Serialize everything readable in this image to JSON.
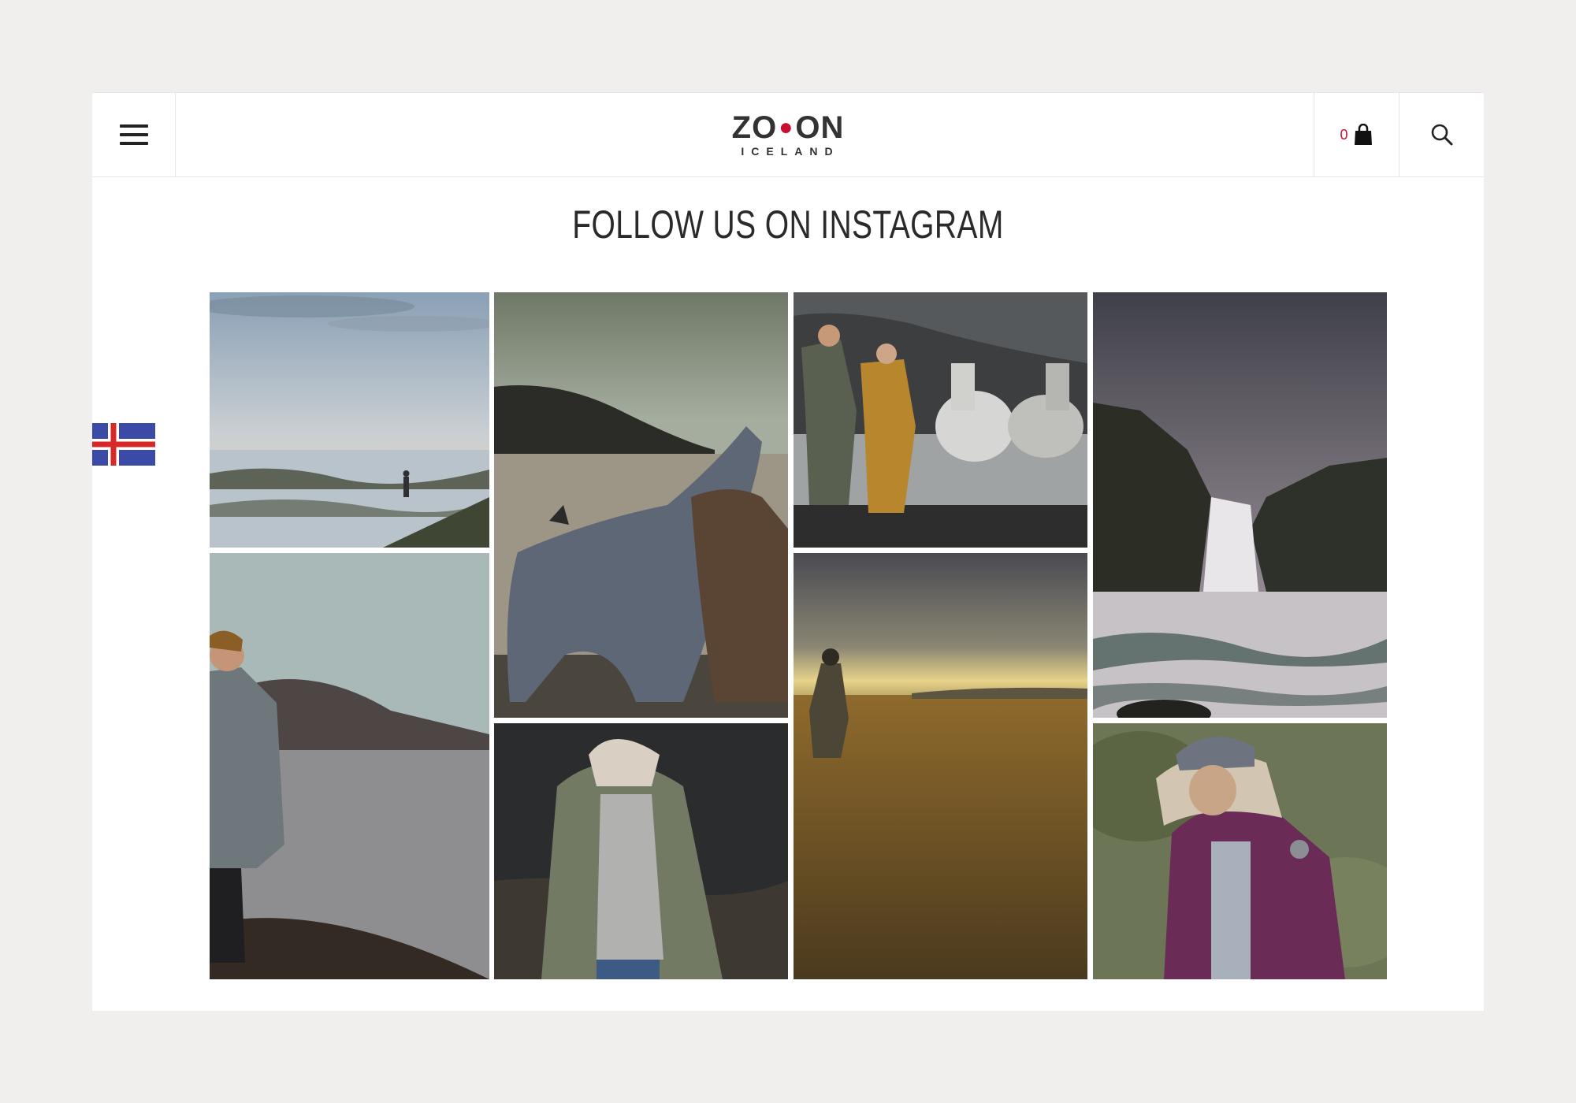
{
  "header": {
    "menu_icon": "hamburger-menu-icon",
    "logo": {
      "main_left": "ZO",
      "main_right": "ON",
      "sub": "ICELAND"
    },
    "cart": {
      "count": "0",
      "icon": "shopping-bag-icon"
    },
    "search_icon": "search-icon"
  },
  "section": {
    "title": "FOLLOW US ON INSTAGRAM"
  },
  "language_flag": {
    "icon": "iceland-flag-icon"
  },
  "colors": {
    "accent": "#c8102e",
    "text": "#2a2a2a",
    "background": "#f0efed"
  },
  "instagram_posts": [
    {
      "name": "instagram-post-lone-walker-river-delta"
    },
    {
      "name": "instagram-post-icelandic-horses-lake"
    },
    {
      "name": "instagram-post-couple-running-with-horses"
    },
    {
      "name": "instagram-post-waterfall-basalt-canyon"
    },
    {
      "name": "instagram-post-woman-lakeside-parka"
    },
    {
      "name": "instagram-post-woman-green-parka"
    },
    {
      "name": "instagram-post-sunset-grass-field"
    },
    {
      "name": "instagram-post-woman-purple-parka"
    }
  ]
}
